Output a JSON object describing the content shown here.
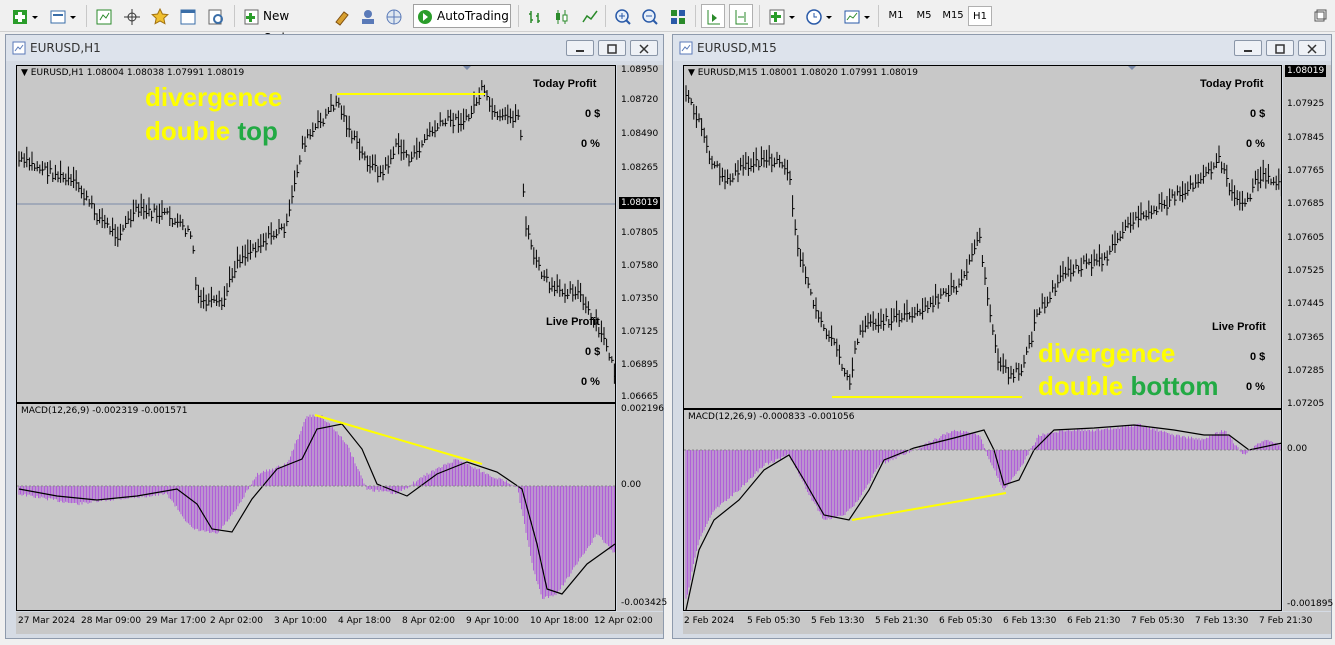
{
  "toolbar": {
    "new_order_label": "New Order",
    "autotrading_label": "AutoTrading",
    "timeframes": [
      "M1",
      "M5",
      "M15",
      "H1"
    ],
    "active_timeframe": "H1"
  },
  "left_window": {
    "title": "EURUSD,H1",
    "info": "EURUSD,H1  1.08004 1.08038 1.07991 1.08019",
    "price_ticks": [
      "1.08950",
      "1.08720",
      "1.08490",
      "1.08265",
      "1.08019",
      "1.07805",
      "1.07580",
      "1.07350",
      "1.07125",
      "1.06895",
      "1.06665"
    ],
    "current_price": "1.08019",
    "today_profit_label": "Today Profit",
    "today_profit_value": "0 $",
    "today_profit_pct": "0 %",
    "live_profit_label": "Live Profit",
    "live_profit_value": "0 $",
    "live_profit_pct": "0 %",
    "annotation_line1": "divergence",
    "annotation_word1": "double",
    "annotation_word2": "top",
    "macd_title": "MACD(12,26,9) -0.002319 -0.001571",
    "macd_ticks": [
      "0.002196",
      "0.00",
      "-0.003425"
    ],
    "time_labels": [
      "27 Mar 2024",
      "28 Mar 09:00",
      "29 Mar 17:00",
      "2 Apr 02:00",
      "3 Apr 10:00",
      "4 Apr 18:00",
      "8 Apr 02:00",
      "9 Apr 10:00",
      "10 Apr 18:00",
      "12 Apr 02:00"
    ]
  },
  "right_window": {
    "title": "EURUSD,M15",
    "info": "EURUSD,M15  1.08001 1.08020 1.07991 1.08019",
    "price_ticks": [
      "1.08019",
      "1.07925",
      "1.07845",
      "1.07765",
      "1.07685",
      "1.07605",
      "1.07525",
      "1.07445",
      "1.07365",
      "1.07285",
      "1.07205"
    ],
    "current_price": "1.08019",
    "today_profit_label": "Today Profit",
    "today_profit_value": "0 $",
    "today_profit_pct": "0 %",
    "live_profit_label": "Live Profit",
    "live_profit_value": "0 $",
    "live_profit_pct": "0 %",
    "annotation_line1": "divergence",
    "annotation_word1": "double",
    "annotation_word2": "bottom",
    "macd_title": "MACD(12,26,9) -0.000833 -0.001056",
    "macd_ticks": [
      "0.00",
      "-0.001895"
    ],
    "time_labels": [
      "2 Feb 2024",
      "5 Feb 05:30",
      "5 Feb 13:30",
      "5 Feb 21:30",
      "6 Feb 05:30",
      "6 Feb 13:30",
      "6 Feb 21:30",
      "7 Feb 05:30",
      "7 Feb 13:30",
      "7 Feb 21:30"
    ]
  },
  "colors": {
    "chart_bg": "#c8c8c8",
    "yellow": "#ffff00",
    "green": "#22aa44",
    "histogram": "#b060d8",
    "candle": "#000000"
  }
}
